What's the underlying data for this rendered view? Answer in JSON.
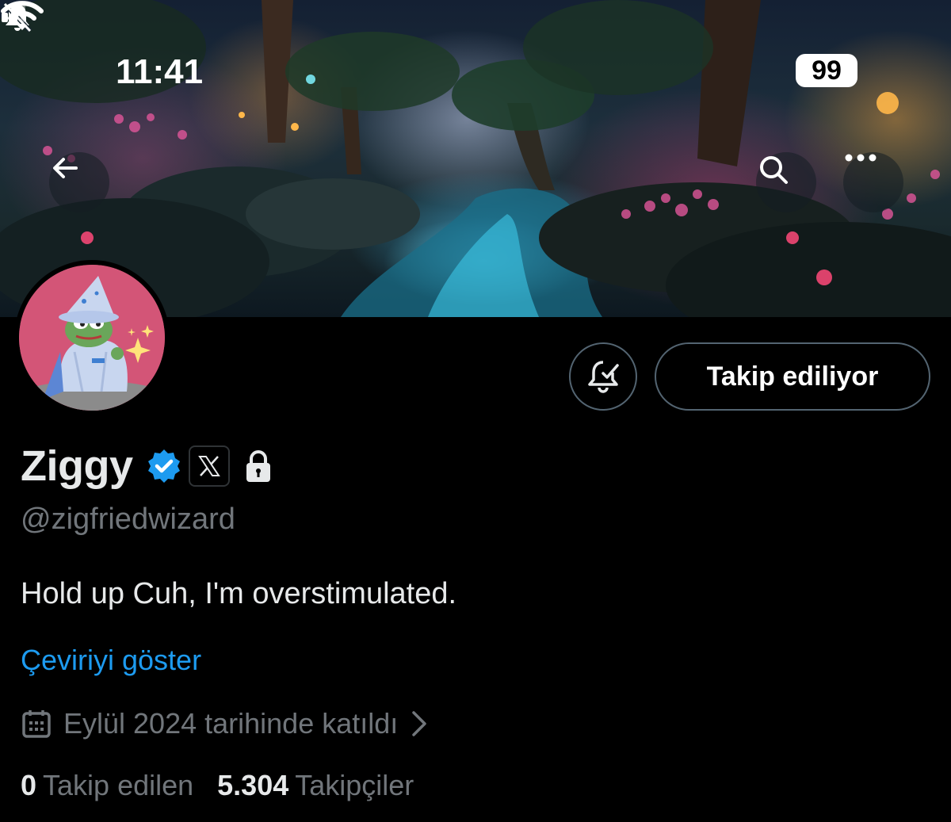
{
  "status_bar": {
    "time": "11:41",
    "battery": "99",
    "icons": [
      "bell-slash-icon",
      "signal-icon",
      "wifi-icon",
      "battery-icon"
    ]
  },
  "banner_buttons": {
    "icons": [
      "back-arrow-icon",
      "search-icon",
      "more-icon"
    ]
  },
  "profile": {
    "display_name": "Ziggy",
    "handle": "@zigfriedwizard",
    "bio": "Hold up Cuh, I'm overstimulated.",
    "translate_label": "Çeviriyi göster",
    "joined": "Eylül 2024 tarihinde katıldı",
    "badges": [
      "verified-badge-icon",
      "x-logo-icon",
      "lock-icon"
    ]
  },
  "actions": {
    "follow_label": "Takip ediliyor",
    "notify_icon": "bell-check-icon"
  },
  "stats": {
    "following_count": "0",
    "following_label": "Takip edilen",
    "followers_count": "5.304",
    "followers_label": "Takipçiler"
  },
  "colors": {
    "background": "#000000",
    "accent_link": "#1d9bf0",
    "verified": "#1d9bf0",
    "secondary_text": "#71767b",
    "primary_text": "#e7e9ea",
    "button_border": "#536471"
  }
}
